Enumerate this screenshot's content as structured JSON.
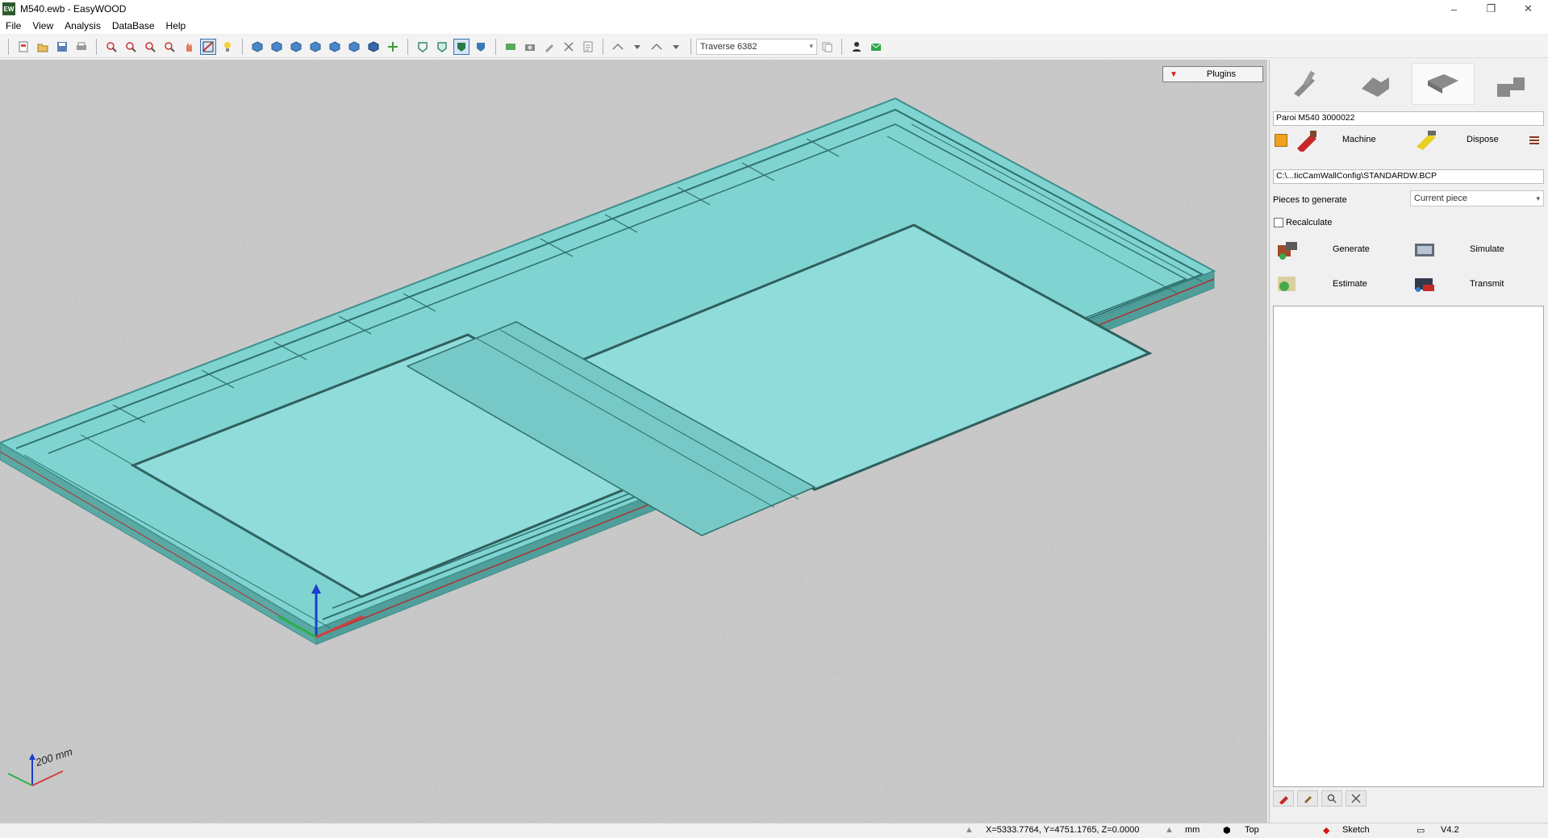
{
  "window": {
    "title": "M540.ewb - EasyWOOD",
    "app_icon_text": "EW",
    "controls": {
      "minimize": "–",
      "maximize": "❐",
      "close": "✕"
    }
  },
  "menu": [
    "File",
    "View",
    "Analysis",
    "DataBase",
    "Help"
  ],
  "toolbar": {
    "profile_combo": "Traverse 6382"
  },
  "viewport": {
    "plugins_label": "Plugins",
    "scale_label": "200 mm"
  },
  "side": {
    "piece_name": "Paroi M540 3000022",
    "machine_label": "Machine",
    "dispose_label": "Dispose",
    "config_path": "C:\\...ticCamWallConfig\\STANDARDW.BCP",
    "pieces_label": "Pieces to generate",
    "pieces_value": "Current piece",
    "recalculate_label": "Recalculate",
    "generate_label": "Generate",
    "simulate_label": "Simulate",
    "estimate_label": "Estimate",
    "transmit_label": "Transmit"
  },
  "status": {
    "coords": "X=5333.7764, Y=4751.1765, Z=0.0000",
    "unit": "mm",
    "view": "Top",
    "mode": "Sketch",
    "version": "V4.2"
  },
  "colors": {
    "panel_fill": "#7fd4d2",
    "panel_frame": "#5fb9b5",
    "viewport_bg": "#c8c8c8",
    "accent_red": "#d01818"
  }
}
